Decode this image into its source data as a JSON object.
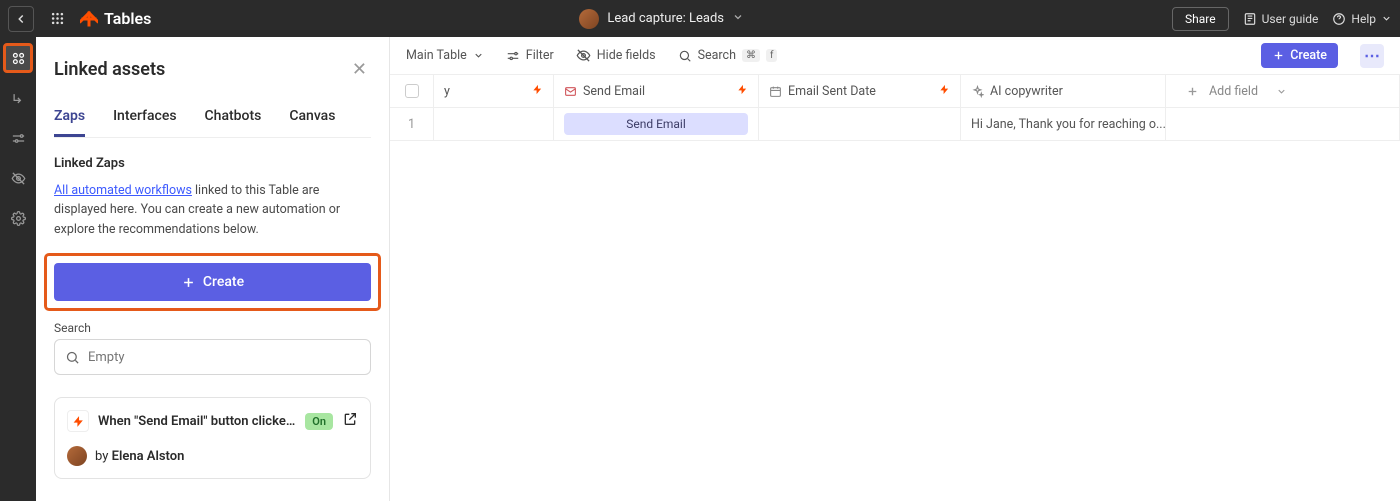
{
  "topbar": {
    "brand": "Tables",
    "doc_title": "Lead capture: Leads",
    "share": "Share",
    "user_guide": "User guide",
    "help": "Help"
  },
  "panel": {
    "title": "Linked assets",
    "tabs": [
      "Zaps",
      "Interfaces",
      "Chatbots",
      "Canvas"
    ],
    "section_title": "Linked Zaps",
    "desc_link": "All automated workflows",
    "desc_rest": " linked to this Table are displayed here. You can create a new automation or explore the recommendations below.",
    "create_label": "Create",
    "search_label": "Search",
    "search_placeholder": "Empty",
    "zap": {
      "title": "When \"Send Email\" button clicked, se...",
      "status": "On",
      "by": "by ",
      "author": "Elena Alston"
    }
  },
  "toolbar": {
    "main_table": "Main Table",
    "filter": "Filter",
    "hide_fields": "Hide fields",
    "search": "Search",
    "kbd1": "⌘",
    "kbd2": "f",
    "create": "Create"
  },
  "table": {
    "headers": {
      "col_a_tail": "y",
      "send_email": "Send Email",
      "email_sent_date": "Email Sent Date",
      "ai_copywriter": "AI copywriter",
      "add_field": "Add field"
    },
    "row1": {
      "num": "1",
      "send_btn": "Send Email",
      "ai_text": "Hi Jane, Thank you for reaching o..."
    }
  }
}
